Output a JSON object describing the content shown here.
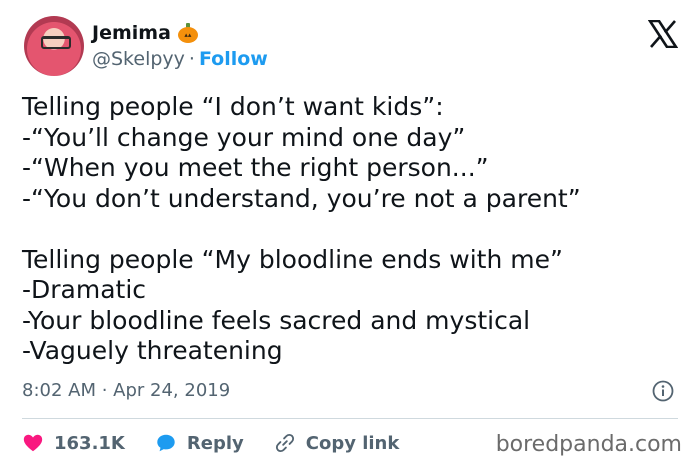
{
  "author": {
    "display_name": "Jemima",
    "handle": "@Skelpyy",
    "separator": "·",
    "follow_label": "Follow",
    "badge_icon": "pumpkin-icon"
  },
  "tweet": {
    "lines": [
      "Telling people “I don’t want kids”:",
      "-“You’ll change your mind one day”",
      "-“When you meet the right person...”",
      "-“You don’t understand, you’re not a parent”",
      "",
      "Telling people “My bloodline ends with me”",
      "-Dramatic",
      "-Your bloodline feels sacred and mystical",
      "-Vaguely threatening"
    ],
    "timestamp": "8:02 AM · Apr 24, 2019"
  },
  "actions": {
    "like_count": "163.1K",
    "reply_label": "Reply",
    "copy_link_label": "Copy link"
  },
  "watermark": "boredpanda.com",
  "colors": {
    "like": "#f91880",
    "reply": "#1d9bf0",
    "link": "#1d9bf0",
    "muted": "#536471",
    "text": "#0f1419"
  }
}
